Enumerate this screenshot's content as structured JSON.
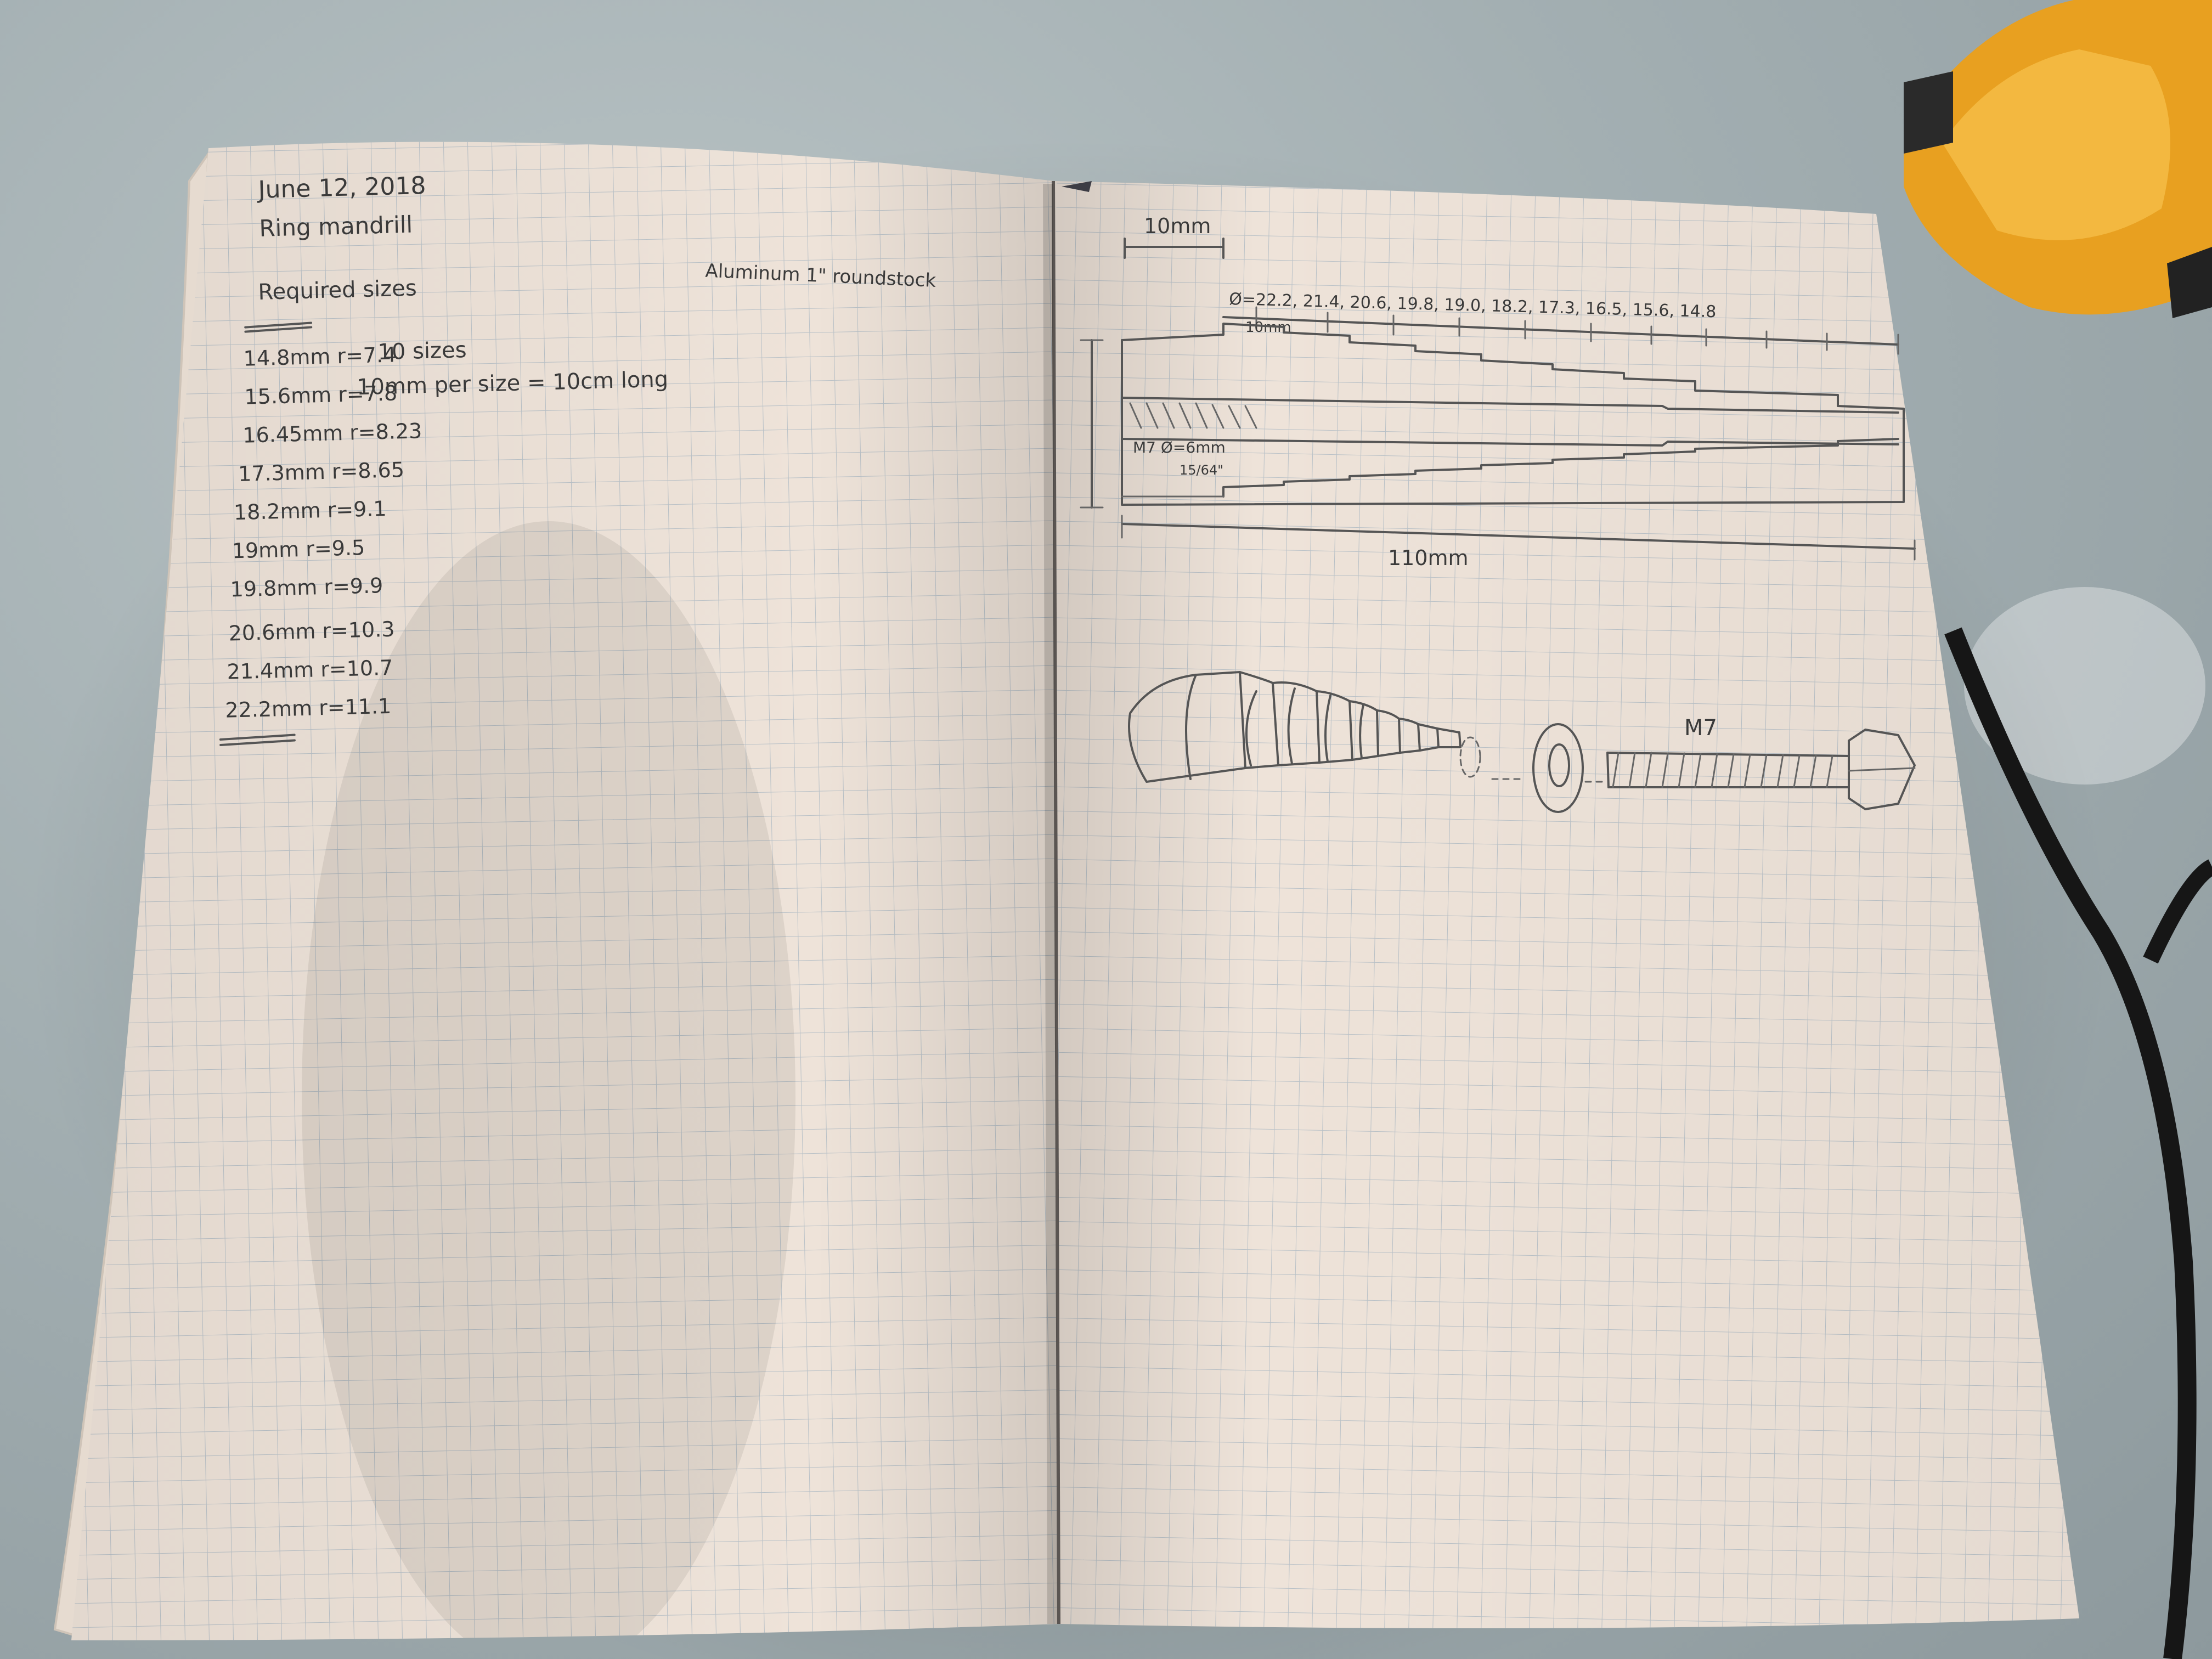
{
  "left_page": {
    "date": "June 12, 2018",
    "title": "Ring mandrill",
    "subtitle": "Required sizes",
    "material_note": "Aluminum 1\" roundstock",
    "sizes": [
      "14.8mm r=7.4",
      "15.6mm r=7.8",
      "16.45mm r=8.23",
      "17.3mm r=8.65",
      "18.2mm r=9.1",
      "19mm r=9.5",
      "19.8mm r=9.9",
      "20.6mm r=10.3",
      "21.4mm r=10.7",
      "22.2mm r=11.1"
    ],
    "size_count_note": "10 sizes",
    "length_note": "10mm per size = 10cm long"
  },
  "right_page": {
    "scale_label": "10mm",
    "diameters_label": "Ø=22.2, 21.4, 20.6, 19.8, 19.0, 18.2, 17.3, 16.5, 15.6, 14.8",
    "step_label": "10mm",
    "bore_label": "M7 Ø=6mm",
    "bore_fraction": "15/64\"",
    "total_length_label": "110mm",
    "bolt_label": "M7"
  },
  "colors": {
    "table": "#a3afb2",
    "paper": "#eee3d9",
    "grid_line": "#b8c0c6",
    "pencil": "#555555",
    "clamp_orange": "#e8a020"
  }
}
